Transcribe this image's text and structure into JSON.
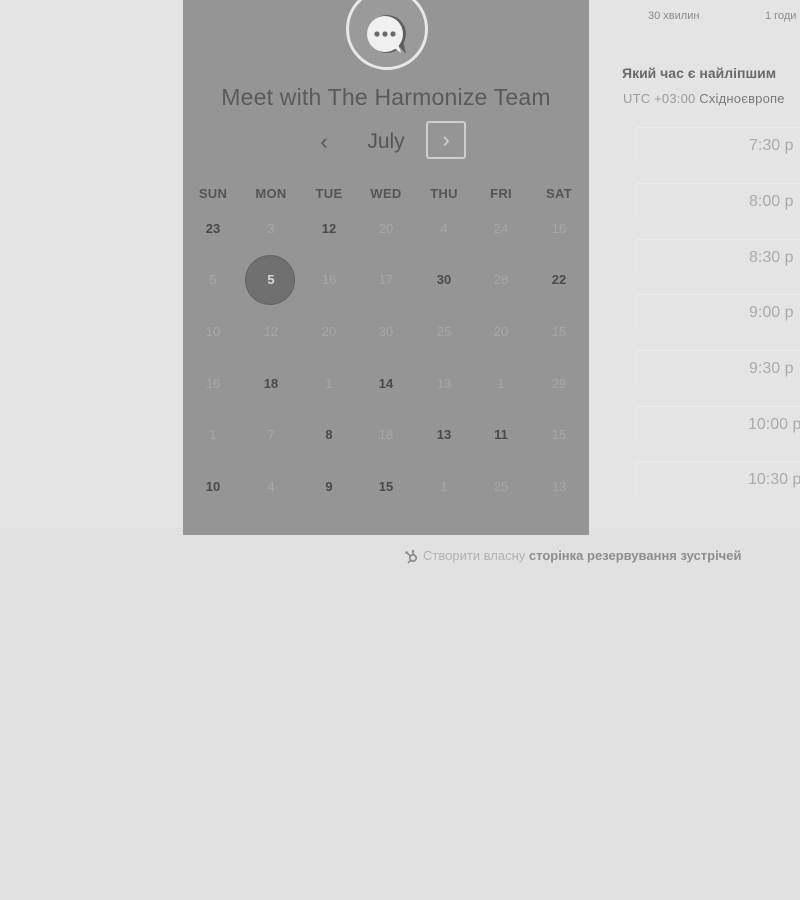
{
  "booking": {
    "title": "Meet with The Harmonize Team",
    "avatar_icon": "chat-bubble-icon"
  },
  "calendar": {
    "month": "July",
    "prev_icon": "‹",
    "next_icon": "›",
    "weekdays": [
      "SUN",
      "MON",
      "TUE",
      "WED",
      "THU",
      "FRI",
      "SAT"
    ],
    "weeks": [
      [
        {
          "d": "23",
          "s": "avail"
        },
        {
          "d": "3",
          "s": "off"
        },
        {
          "d": "12",
          "s": "avail"
        },
        {
          "d": "20",
          "s": "off"
        },
        {
          "d": "4",
          "s": "off"
        },
        {
          "d": "24",
          "s": "off"
        },
        {
          "d": "16",
          "s": "off"
        }
      ],
      [
        {
          "d": "5",
          "s": "off"
        },
        {
          "d": "5",
          "s": "selected"
        },
        {
          "d": "16",
          "s": "off"
        },
        {
          "d": "17",
          "s": "off"
        },
        {
          "d": "30",
          "s": "avail"
        },
        {
          "d": "28",
          "s": "off"
        },
        {
          "d": "22",
          "s": "avail"
        }
      ],
      [
        {
          "d": "10",
          "s": "off"
        },
        {
          "d": "12",
          "s": "off"
        },
        {
          "d": "20",
          "s": "off"
        },
        {
          "d": "30",
          "s": "off"
        },
        {
          "d": "25",
          "s": "off"
        },
        {
          "d": "20",
          "s": "off"
        },
        {
          "d": "15",
          "s": "off"
        }
      ],
      [
        {
          "d": "16",
          "s": "off"
        },
        {
          "d": "18",
          "s": "avail"
        },
        {
          "d": "1",
          "s": "off"
        },
        {
          "d": "14",
          "s": "avail"
        },
        {
          "d": "13",
          "s": "off"
        },
        {
          "d": "1",
          "s": "off"
        },
        {
          "d": "29",
          "s": "off"
        }
      ],
      [
        {
          "d": "1",
          "s": "off"
        },
        {
          "d": "7",
          "s": "off"
        },
        {
          "d": "8",
          "s": "avail"
        },
        {
          "d": "18",
          "s": "off"
        },
        {
          "d": "13",
          "s": "avail"
        },
        {
          "d": "11",
          "s": "avail"
        },
        {
          "d": "15",
          "s": "off"
        }
      ],
      [
        {
          "d": "10",
          "s": "avail"
        },
        {
          "d": "4",
          "s": "off"
        },
        {
          "d": "9",
          "s": "avail"
        },
        {
          "d": "15",
          "s": "avail"
        },
        {
          "d": "1",
          "s": "off"
        },
        {
          "d": "25",
          "s": "off"
        },
        {
          "d": "13",
          "s": "off"
        }
      ]
    ]
  },
  "durations": [
    "30 хвилин",
    "1 годи"
  ],
  "times_panel": {
    "question": "Який час є найліпшим",
    "tz_prefix": "UTC +03:00",
    "tz_name": "Східноєвропе",
    "slots": [
      "7:30 p",
      "8:00 p",
      "8:30 p",
      "9:00 p",
      "9:30 p",
      "10:00 p",
      "10:30 p"
    ]
  },
  "footer": {
    "prefix": "Створити власну",
    "link": "сторінка резервування зустрічей",
    "icon": "hubspot-sprocket-icon"
  }
}
